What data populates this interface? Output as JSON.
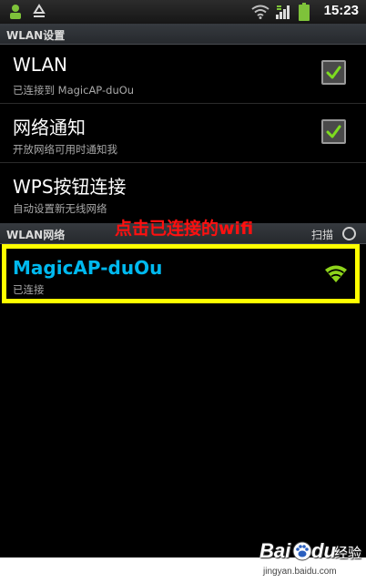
{
  "status_bar": {
    "time": "15:23",
    "icons": [
      "usb-icon",
      "recycle-icon",
      "wifi-icon",
      "signal-icon",
      "battery-icon"
    ]
  },
  "wlan_settings": {
    "header": "WLAN设置",
    "items": [
      {
        "title": "WLAN",
        "summary": "已连接到 MagicAP-duOu",
        "checked": true
      },
      {
        "title": "网络通知",
        "summary": "开放网络可用时通知我",
        "checked": true
      },
      {
        "title": "WPS按钮连接",
        "summary": "自动设置新无线网络"
      }
    ]
  },
  "networks": {
    "header": "WLAN网络",
    "scan_label": "扫描",
    "items": [
      {
        "name": "MagicAP-duOu",
        "status": "已连接",
        "signal_icon": "wifi-signal-icon"
      }
    ]
  },
  "annotation": {
    "text": "点击已连接的wifi"
  },
  "colors": {
    "background": "#000000",
    "network_name": "#00b9ef",
    "checkmark": "#7ddc1f",
    "wifi_signal": "#8ed41b",
    "annotation": "#ff1010",
    "highlight": "#ffff00"
  },
  "watermark": {
    "url": "jingyan.baidu.com"
  }
}
